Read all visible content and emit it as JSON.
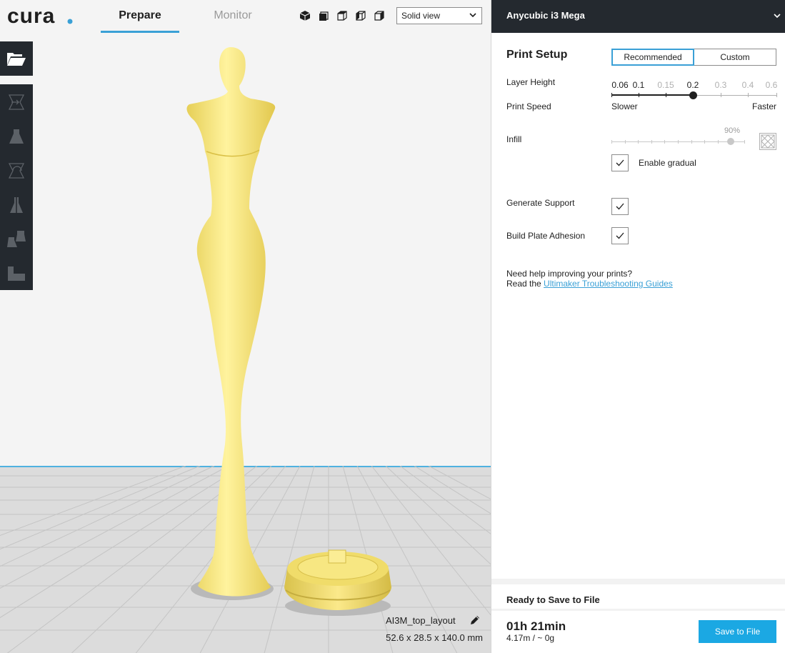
{
  "app": {
    "logo_text": "cura."
  },
  "tabs": [
    {
      "label": "Prepare",
      "active": true
    },
    {
      "label": "Monitor",
      "active": false
    }
  ],
  "view_mode": {
    "selected": "Solid view"
  },
  "view_icons": [
    "3d-view-icon",
    "front-view-icon",
    "top-view-icon",
    "left-view-icon",
    "right-view-icon"
  ],
  "toolbar": {
    "open": "folder-open-icon",
    "tools": [
      "move-tool-icon",
      "scale-tool-icon",
      "rotate-tool-icon",
      "mirror-tool-icon",
      "per-model-settings-icon",
      "support-blocker-icon"
    ]
  },
  "object": {
    "name": "AI3M_top_layout",
    "dimensions": "52.6 x 28.5 x 140.0 mm"
  },
  "machine": {
    "name": "Anycubic i3 Mega"
  },
  "print_setup": {
    "title": "Print Setup",
    "modes": [
      "Recommended",
      "Custom"
    ],
    "active_mode": "Recommended",
    "layer_height": {
      "label": "Layer Height",
      "values": [
        "0.06",
        "0.1",
        "0.15",
        "0.2",
        "0.3",
        "0.4",
        "0.6"
      ],
      "selected": "0.2"
    },
    "print_speed": {
      "label": "Print Speed",
      "slow": "Slower",
      "fast": "Faster"
    },
    "infill": {
      "label": "Infill",
      "percent_label": "90%",
      "value": 90,
      "gradual_label": "Enable gradual",
      "gradual_checked": true
    },
    "support": {
      "label": "Generate Support",
      "checked": true
    },
    "adhesion": {
      "label": "Build Plate Adhesion",
      "checked": true
    },
    "help_line1": "Need help improving your prints?",
    "help_read": "Read the",
    "help_link": "Ultimaker Troubleshooting Guides"
  },
  "job": {
    "status": "Ready to Save to File",
    "time": "01h 21min",
    "material": "4.17m / ~ 0g",
    "save_label": "Save to File"
  },
  "colors": {
    "accent": "#3aa0d6",
    "save_button": "#1ba8e3",
    "model": "#f6e77a",
    "toolbar": "#24292f"
  }
}
